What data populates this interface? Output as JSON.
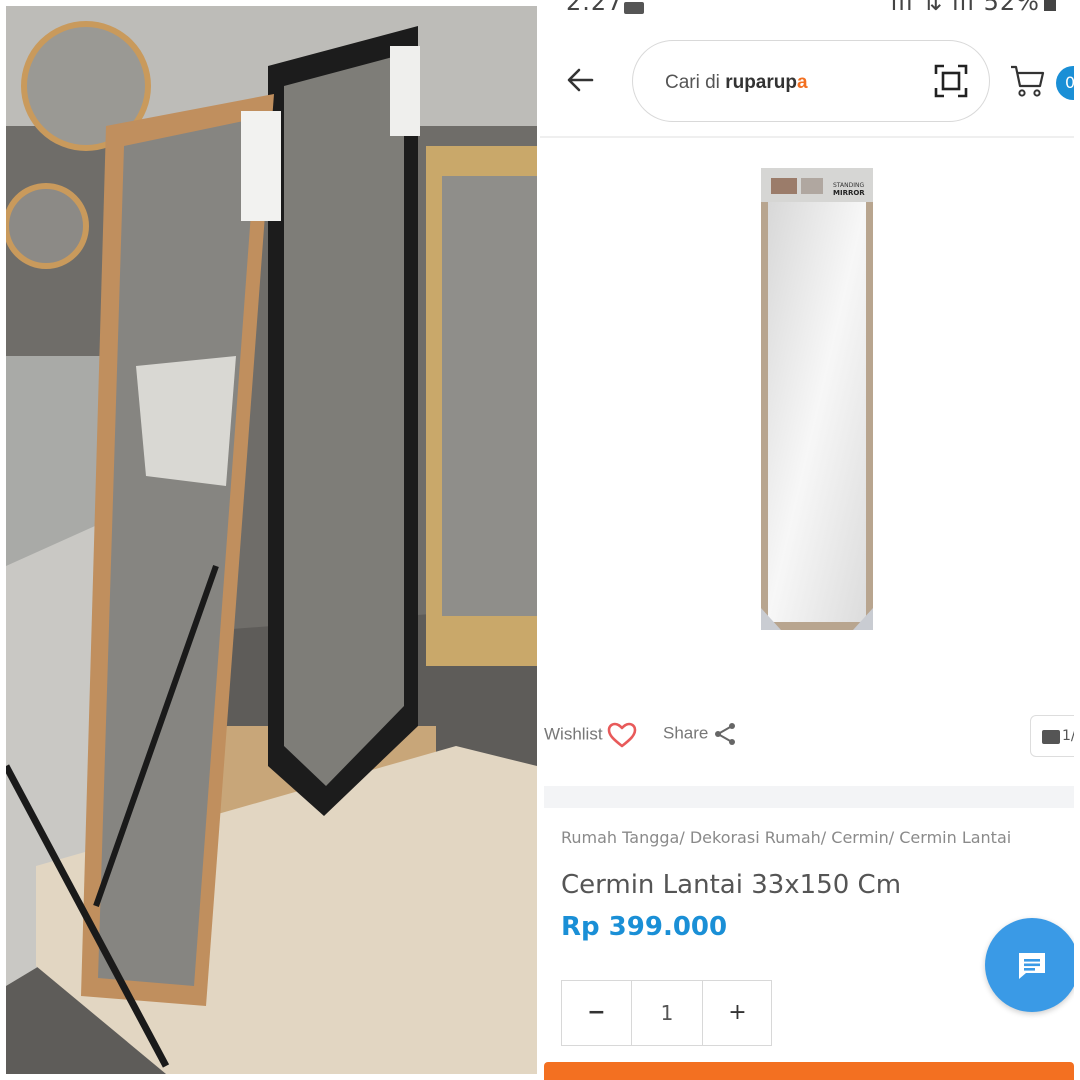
{
  "status_bar": {
    "time": "2.27",
    "right": "ıll ⇅ ıll 52%"
  },
  "header": {
    "search_prefix": "Cari di ",
    "brand_a": "rupa",
    "brand_b": "rup",
    "brand_c": "a",
    "cart_count": "0"
  },
  "actions": {
    "wishlist_label": "Wishlist",
    "share_label": "Share",
    "gallery_counter": "1/"
  },
  "product": {
    "breadcrumb": [
      "Rumah Tangga/",
      "Dekorasi Rumah/",
      "Cermin/",
      "Cermin Lantai"
    ],
    "title": "Cermin Lantai 33x150 Cm",
    "price": "Rp 399.000",
    "quantity": "1",
    "minus_label": "−",
    "plus_label": "+",
    "packaging_label_1": "STANDING",
    "packaging_label_2": "MIRROR"
  },
  "colors": {
    "accent_blue": "#1a8fd6",
    "accent_orange": "#f37021",
    "wishlist_heart": "#e85a5a"
  }
}
